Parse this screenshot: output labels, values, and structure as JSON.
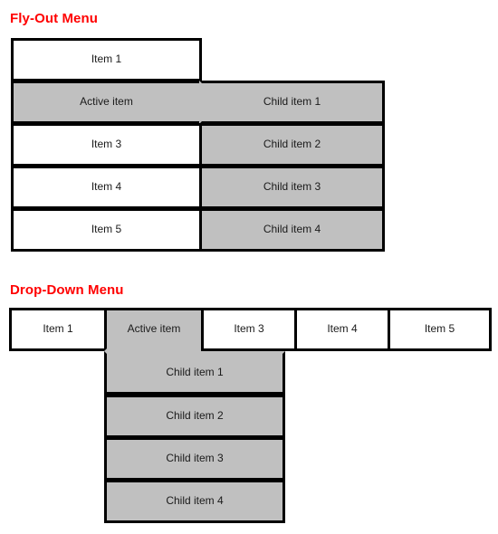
{
  "colors": {
    "heading": "#ff0000",
    "active_fill": "#c0c0c0",
    "item_fill": "#ffffff",
    "border": "#000000",
    "text": "#1a1a1a"
  },
  "flyout": {
    "heading": "Fly-Out Menu",
    "parent_items": [
      {
        "label": "Item 1",
        "state": "normal"
      },
      {
        "label": "Active item",
        "state": "active"
      },
      {
        "label": "Item 3",
        "state": "normal"
      },
      {
        "label": "Item 4",
        "state": "normal"
      },
      {
        "label": "Item 5",
        "state": "normal"
      }
    ],
    "child_items": [
      {
        "label": "Child item 1",
        "state": "active"
      },
      {
        "label": "Child item 2",
        "state": "active"
      },
      {
        "label": "Child item 3",
        "state": "active"
      },
      {
        "label": "Child item 4",
        "state": "active"
      }
    ]
  },
  "dropdown": {
    "heading": "Drop-Down Menu",
    "bar_items": [
      {
        "label": "Item 1",
        "state": "normal"
      },
      {
        "label": "Active item",
        "state": "active"
      },
      {
        "label": "Item 3",
        "state": "normal"
      },
      {
        "label": "Item 4",
        "state": "normal"
      },
      {
        "label": "Item 5",
        "state": "normal"
      }
    ],
    "child_items": [
      {
        "label": "Child item 1",
        "state": "active"
      },
      {
        "label": "Child item 2",
        "state": "active"
      },
      {
        "label": "Child item 3",
        "state": "active"
      },
      {
        "label": "Child item 4",
        "state": "active"
      }
    ]
  }
}
